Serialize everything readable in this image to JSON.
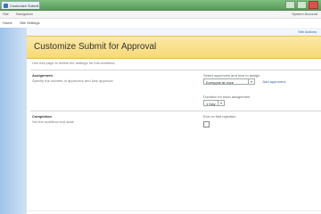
{
  "browser": {
    "tab_title": "Customize Submit"
  },
  "menubar": {
    "items": [
      "Site",
      "Navigation"
    ],
    "user_label": "System Account"
  },
  "nav": {
    "links": [
      "Home",
      "Site Settings"
    ]
  },
  "site_actions": "Site Actions",
  "page": {
    "title": "Customize Submit for Approval",
    "subtitle": "Use this page to define the settings for this workflow."
  },
  "sections": [
    {
      "title": "Assignment",
      "description": "Specify the number of approvers and how approval",
      "fields": {
        "approval_label": "Select approvers and how to assign",
        "approval_value": "Everyone at once",
        "approval_link": "Add approvers",
        "duration_label": "Duration for each assignment",
        "duration_value": "1 Day"
      }
    },
    {
      "title": "Completion",
      "description": "Set the workflow end state",
      "fields": {
        "end_label": "End on first rejection",
        "end_checked": false
      }
    }
  ],
  "colors": {
    "title_band": "#f7d978",
    "left_band": "#9fc3ea",
    "topbar": "#5a9a5a"
  }
}
